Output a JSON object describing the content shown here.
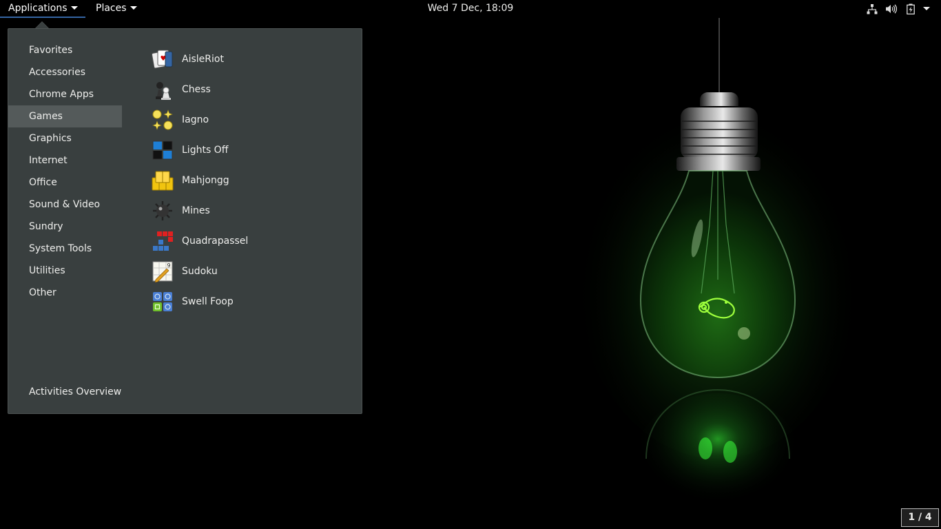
{
  "topbar": {
    "applications_label": "Applications",
    "places_label": "Places",
    "clock": "Wed  7 Dec, 18:09",
    "tray_icons": [
      "network-icon",
      "volume-icon",
      "battery-icon",
      "system-menu-caret"
    ]
  },
  "menu": {
    "categories": [
      {
        "label": "Favorites"
      },
      {
        "label": "Accessories"
      },
      {
        "label": "Chrome Apps"
      },
      {
        "label": "Games",
        "selected": true
      },
      {
        "label": "Graphics"
      },
      {
        "label": "Internet"
      },
      {
        "label": "Office"
      },
      {
        "label": "Sound & Video"
      },
      {
        "label": "Sundry"
      },
      {
        "label": "System Tools"
      },
      {
        "label": "Utilities"
      },
      {
        "label": "Other"
      }
    ],
    "activities_overview": "Activities Overview",
    "apps": [
      {
        "label": "AisleRiot",
        "icon": "cards-icon"
      },
      {
        "label": "Chess",
        "icon": "chess-icon"
      },
      {
        "label": "Iagno",
        "icon": "iagno-icon"
      },
      {
        "label": "Lights Off",
        "icon": "lights-off-icon"
      },
      {
        "label": "Mahjongg",
        "icon": "mahjongg-icon"
      },
      {
        "label": "Mines",
        "icon": "mine-icon"
      },
      {
        "label": "Quadrapassel",
        "icon": "tetromino-icon"
      },
      {
        "label": "Sudoku",
        "icon": "sudoku-icon"
      },
      {
        "label": "Swell Foop",
        "icon": "swell-foop-icon"
      }
    ]
  },
  "workspace": {
    "indicator": "1 / 4"
  },
  "colors": {
    "panel": "#000000",
    "popup_bg": "#393f3f",
    "selected_bg": "#545a5a",
    "accent": "#3465a4",
    "bulb_glow": "#33cc33"
  }
}
